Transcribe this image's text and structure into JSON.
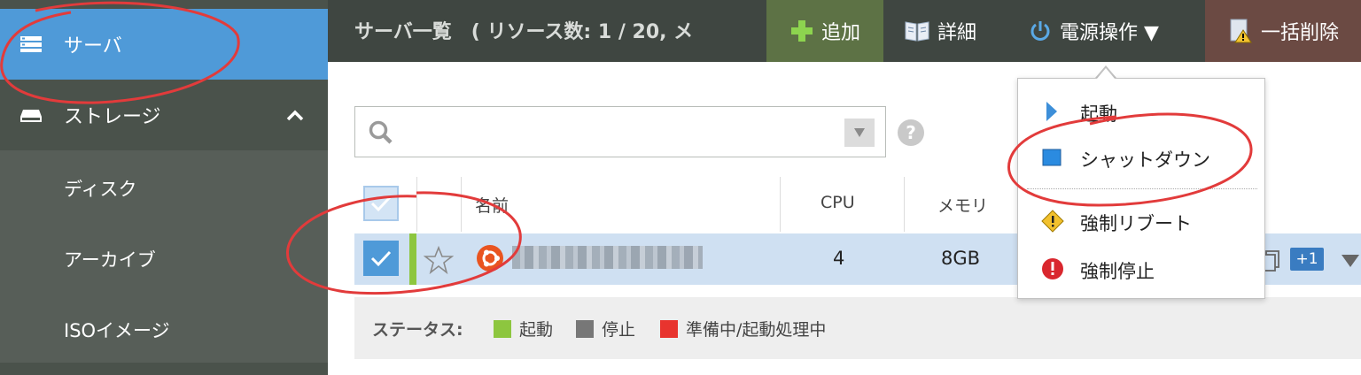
{
  "sidebar": {
    "items": [
      {
        "label": "サーバ",
        "icon": "server-icon",
        "active": true
      },
      {
        "label": "ストレージ",
        "icon": "storage-icon",
        "expanded": true
      }
    ],
    "storage_children": [
      "ディスク",
      "アーカイブ",
      "ISOイメージ"
    ]
  },
  "header": {
    "title": "サーバ一覧　( リソース数: 1 / 20, メ",
    "buttons": {
      "add": "追加",
      "detail": "詳細",
      "power": "電源操作 ▼",
      "bulk_delete": "一括削除"
    }
  },
  "search": {
    "placeholder": "",
    "value": ""
  },
  "table": {
    "columns": [
      "名前",
      "CPU",
      "メモリ"
    ],
    "rows": [
      {
        "name": "██████ ████ █████",
        "cpu": "4",
        "memory": "8GB",
        "badge": "+1",
        "checked": true,
        "status": "running"
      }
    ]
  },
  "legend": {
    "title": "ステータス:",
    "items": [
      {
        "label": "起動",
        "color": "#8dc63f"
      },
      {
        "label": "停止",
        "color": "#777777"
      },
      {
        "label": "準備中/起動処理中",
        "color": "#e8342e"
      }
    ]
  },
  "power_menu": {
    "items": [
      {
        "label": "起動",
        "icon": "play-icon"
      },
      {
        "label": "シャットダウン",
        "icon": "stop-icon"
      },
      {
        "label": "強制リブート",
        "icon": "warning-icon"
      },
      {
        "label": "強制停止",
        "icon": "error-icon"
      }
    ]
  },
  "colors": {
    "accent": "#4f9ad8",
    "sidebar": "#4a524b",
    "topbar": "#3f4641",
    "add_button": "#5d7245",
    "delete_button": "#6b4a43",
    "annotation": "#e23b3b"
  }
}
